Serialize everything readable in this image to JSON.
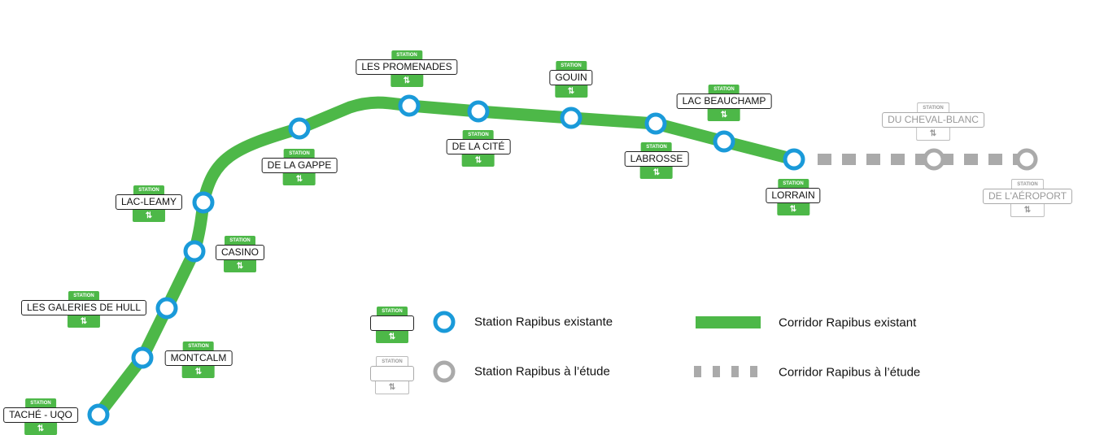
{
  "colors": {
    "corridor_existing": "#4db848",
    "station_existing": "#1a9ad9",
    "study": "#aaaaaa"
  },
  "station_tab_label": "STATION",
  "transfer_icon": "transfer-icon",
  "stations": [
    {
      "name": "TACHÉ - UQO",
      "status": "existing"
    },
    {
      "name": "MONTCALM",
      "status": "existing"
    },
    {
      "name": "LES GALERIES DE HULL",
      "status": "existing"
    },
    {
      "name": "CASINO",
      "status": "existing"
    },
    {
      "name": "LAC-LEAMY",
      "status": "existing"
    },
    {
      "name": "DE LA GAPPE",
      "status": "existing"
    },
    {
      "name": "LES PROMENADES",
      "status": "existing"
    },
    {
      "name": "DE LA CITÉ",
      "status": "existing"
    },
    {
      "name": "GOUIN",
      "status": "existing"
    },
    {
      "name": "LABROSSE",
      "status": "existing"
    },
    {
      "name": "LAC BEAUCHAMP",
      "status": "existing"
    },
    {
      "name": "LORRAIN",
      "status": "existing"
    },
    {
      "name": "DU CHEVAL-BLANC",
      "status": "study"
    },
    {
      "name": "DE L'AÉROPORT",
      "status": "study"
    }
  ],
  "legend": {
    "station_existing": "Station Rapibus existante",
    "station_study": "Station Rapibus à l’étude",
    "corridor_existing": "Corridor Rapibus existant",
    "corridor_study": "Corridor Rapibus à l’étude"
  }
}
